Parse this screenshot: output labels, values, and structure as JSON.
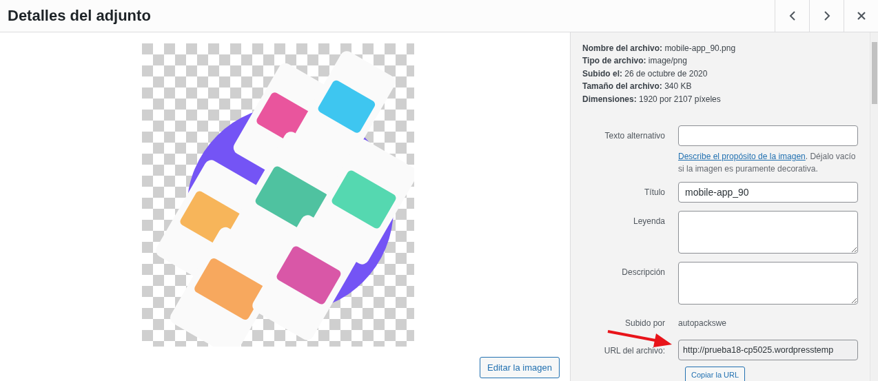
{
  "header": {
    "title": "Detalles del adjunto",
    "nav": [
      {
        "kind": "prev"
      },
      {
        "kind": "next"
      },
      {
        "kind": "close"
      }
    ]
  },
  "preview": {
    "edit_button": "Editar la imagen"
  },
  "meta": [
    {
      "label": "Nombre del archivo:",
      "value": "mobile-app_90.png"
    },
    {
      "label": "Tipo de archivo:",
      "value": "image/png"
    },
    {
      "label": "Subido el:",
      "value": "26 de octubre de 2020"
    },
    {
      "label": "Tamaño del archivo:",
      "value": "340 KB"
    },
    {
      "label": "Dimensiones:",
      "value": "1920 por 2107 píxeles"
    }
  ],
  "fields": [
    {
      "kind": "input",
      "label": "Texto alternativo",
      "help_link": "Describe el propósito de la imagen",
      "help_text": ". Déjalo vacío si la imagen es puramente decorativa."
    },
    {
      "kind": "input",
      "label": "Título",
      "value": "mobile-app_90"
    },
    {
      "kind": "textarea",
      "label": "Leyenda"
    },
    {
      "kind": "textarea",
      "label": "Descripción"
    },
    {
      "kind": "text",
      "label": "Subido por",
      "value": "autopackswe"
    },
    {
      "kind": "readonly",
      "label": "URL del archivo:",
      "value": "http://prueba18-cp5025.wordpresstemp",
      "button": "Copiar la URL"
    }
  ]
}
